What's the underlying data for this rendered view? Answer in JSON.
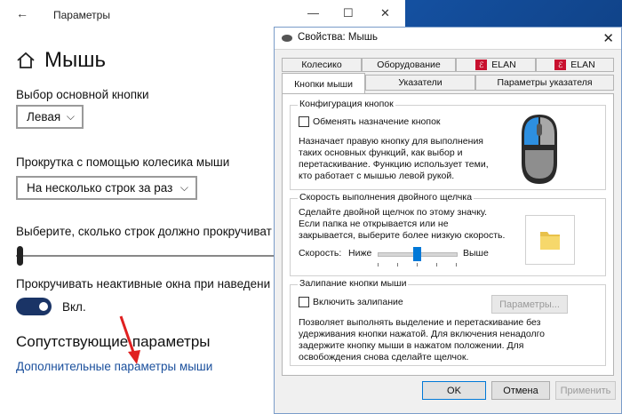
{
  "settings": {
    "window_title": "Параметры",
    "back_icon": "back-arrow-icon",
    "page_title": "Мышь",
    "primary_button_label": "Выбор основной кнопки",
    "primary_button_value": "Левая",
    "scroll_label": "Прокрутка с помощью колесика мыши",
    "scroll_value": "На несколько строк за раз",
    "lines_label": "Выберите, сколько строк должно прокручиват",
    "inactive_scroll_label": "Прокручивать неактивные окна при наведени",
    "toggle_state": "Вкл.",
    "related_heading": "Сопутствующие параметры",
    "additional_link": "Дополнительные параметры мыши",
    "window_controls": {
      "minimize": "—",
      "maximize": "☐",
      "close": "✕"
    },
    "annotation_color": "#e02020"
  },
  "dialog": {
    "title": "Свойства: Мышь",
    "close": "✕",
    "tabs_row1": [
      {
        "label": "Колесико",
        "icon": ""
      },
      {
        "label": "Оборудование",
        "icon": ""
      },
      {
        "label": "ELAN",
        "icon": "elan-icon"
      },
      {
        "label": "ELAN",
        "icon": "elan-icon"
      }
    ],
    "tabs_row2": [
      {
        "label": "Кнопки мыши",
        "active": true
      },
      {
        "label": "Указатели",
        "active": false
      },
      {
        "label": "Параметры указателя",
        "active": false
      }
    ],
    "config_group": {
      "title": "Конфигурация кнопок",
      "checkbox_label": "Обменять назначение кнопок",
      "checked": false,
      "description": [
        "Назначает правую кнопку для выполнения",
        "таких основных функций, как выбор и",
        "перетаскивание. Функцию использует теми,",
        "кто работает с мышью левой рукой."
      ]
    },
    "doubleclick_group": {
      "title": "Скорость выполнения двойного щелчка",
      "description": [
        "Сделайте двойной щелчок по этому значку.",
        "Если папка не открывается или не",
        "закрывается, выберите более низкую скорость."
      ],
      "speed_label": "Скорость:",
      "slow_label": "Ниже",
      "fast_label": "Выше",
      "speed_value": 0.5
    },
    "clicklock_group": {
      "title": "Залипание кнопки мыши",
      "checkbox_label": "Включить залипание",
      "checked": false,
      "settings_button": "Параметры...",
      "description": [
        "Позволяет выполнять выделение и перетаскивание без",
        "удерживания кнопки нажатой. Для включения ненадолго",
        "задержите кнопку мыши в нажатом положении. Для",
        "освобождения снова сделайте щелчок."
      ]
    },
    "buttons": {
      "ok": "OK",
      "cancel": "Отмена",
      "apply": "Применить"
    },
    "accent_color": "#0078d7"
  }
}
